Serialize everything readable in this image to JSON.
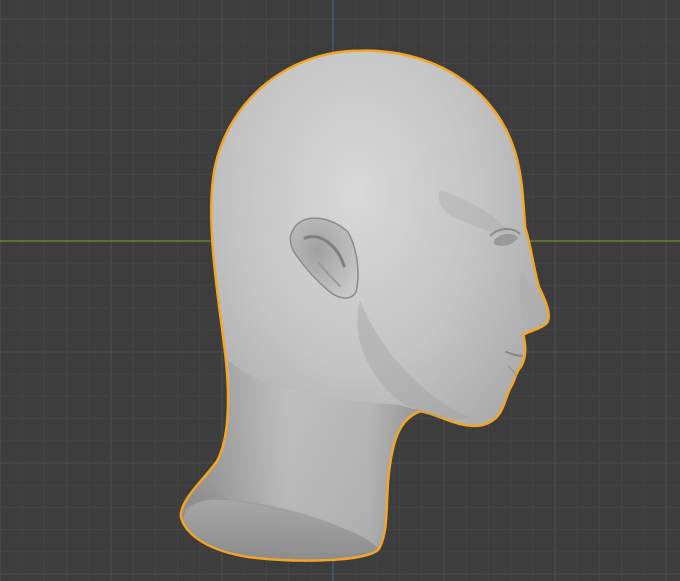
{
  "viewport": {
    "background_color": "#3d3d3d",
    "grid_minor_color": "#454545",
    "grid_major_color": "#4e4e4e",
    "axis_x_color": "#6c8a3b",
    "axis_y_color": "#4a5f8a",
    "selection_outline_color": "#f5a524"
  },
  "object": {
    "type": "head-mesh",
    "shading": "solid",
    "selected": true,
    "surface_color": "#bdbdbd"
  }
}
